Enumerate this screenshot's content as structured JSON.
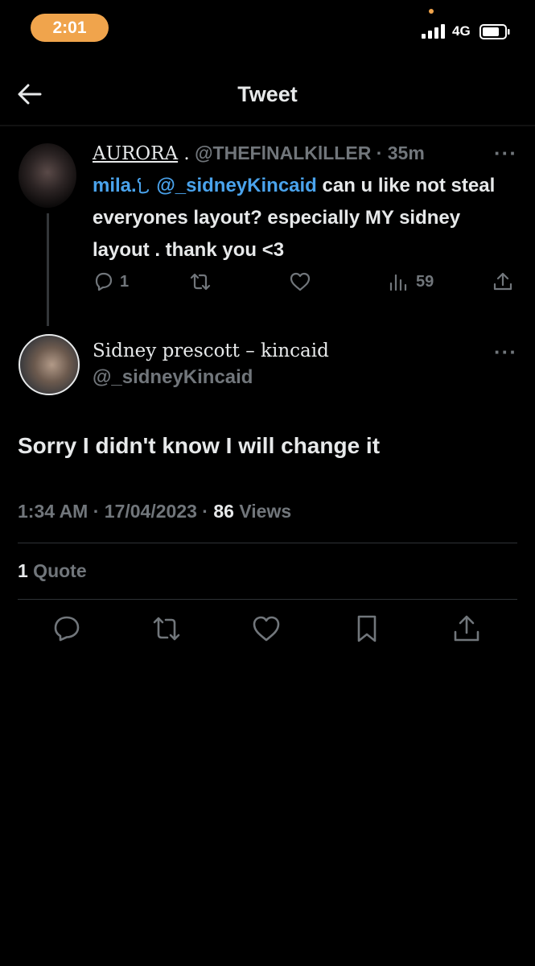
{
  "status": {
    "time": "2:01",
    "network": "4G"
  },
  "header": {
    "title": "Tweet"
  },
  "parent_tweet": {
    "display_name": "AURORA",
    "name_suffix": " .",
    "handle": "@THEFlNALKlLLER",
    "separator": " · ",
    "age": "35m",
    "mention_prefix": "mila.",
    "mention_handle": "@_sidneyKincaid",
    "text": " can u like not steal everyones layout? especially MY sidney layout . thank you <3",
    "replies": "1",
    "views": "59"
  },
  "main_tweet": {
    "display_name": "Sidney prescott – kincaid",
    "handle": "@_sidneyKincaid",
    "text": "Sorry I didn't know I will change it",
    "time": "1:34 AM",
    "date": "17/04/2023",
    "views_count": "86",
    "views_label": " Views",
    "quotes_count": "1",
    "quotes_label": " Quote"
  },
  "icons": [
    "back-arrow-icon",
    "more-icon",
    "reply-icon",
    "retweet-icon",
    "like-icon",
    "views-icon",
    "share-icon",
    "bookmark-icon"
  ]
}
